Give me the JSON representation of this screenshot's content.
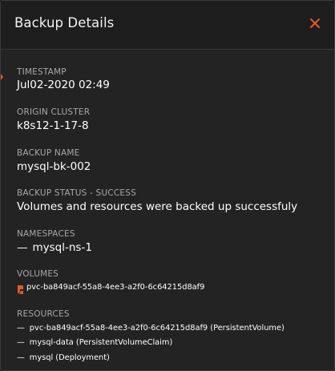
{
  "dialog": {
    "title": "Backup Details",
    "accent_color": "#e05a2b"
  },
  "fields": {
    "timestamp": {
      "label": "TIMESTAMP",
      "value": "Jul02-2020 02:49"
    },
    "origin_cluster": {
      "label": "ORIGIN CLUSTER",
      "value": "k8s12-1-17-8"
    },
    "backup_name": {
      "label": "BACKUP NAME",
      "value": "mysql-bk-002"
    },
    "backup_status": {
      "label": "BACKUP STATUS - SUCCESS",
      "value": "Volumes and resources were backed up successfuly"
    },
    "namespaces": {
      "label": "NAMESPACES",
      "items": [
        "mysql-ns-1"
      ]
    },
    "volumes": {
      "label": "VOLUMES",
      "items": [
        {
          "icon": "volume-icon",
          "name": "pvc-ba849acf-55a8-4ee3-a2f0-6c64215d8af9"
        }
      ]
    },
    "resources": {
      "label": "RESOURCES",
      "items": [
        "pvc-ba849acf-55a8-4ee3-a2f0-6c64215d8af9 (PersistentVolume)",
        "mysql-data (PersistentVolumeClaim)",
        "mysql (Deployment)"
      ]
    }
  },
  "dash_glyph": "—"
}
